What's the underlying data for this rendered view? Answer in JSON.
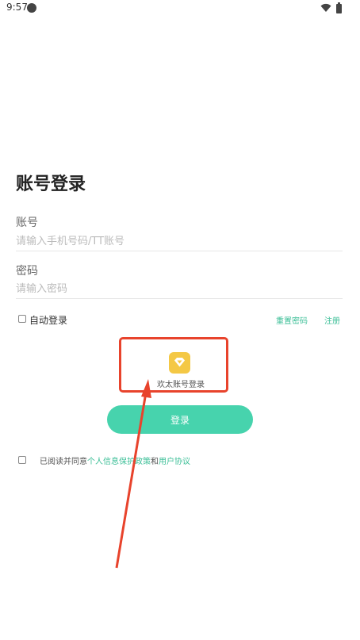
{
  "status_bar": {
    "time": "9:57",
    "icons": [
      "notification-dot-icon",
      "wifi-icon",
      "battery-icon"
    ]
  },
  "login": {
    "title": "账号登录",
    "account": {
      "label": "账号",
      "placeholder": "请输入手机号码/TT账号",
      "value": ""
    },
    "password": {
      "label": "密码",
      "placeholder": "请输入密码",
      "value": ""
    },
    "auto_login": {
      "label": "自动登录",
      "checked": false
    },
    "reset_password_label": "重置密码",
    "register_label": "注册",
    "third_party": {
      "label": "欢太账号登录",
      "icon": "heytap-diamond-icon"
    },
    "login_button_label": "登录",
    "agreement": {
      "checked": false,
      "prefix": "已阅读并同意",
      "privacy_link": "个人信息保护政策",
      "conjunction": "和",
      "terms_link": "用户协议"
    }
  },
  "colors": {
    "accent": "#47d3ad",
    "link": "#3cbf97",
    "annotation": "#e8432c",
    "icon_bg": "#f4c845"
  }
}
